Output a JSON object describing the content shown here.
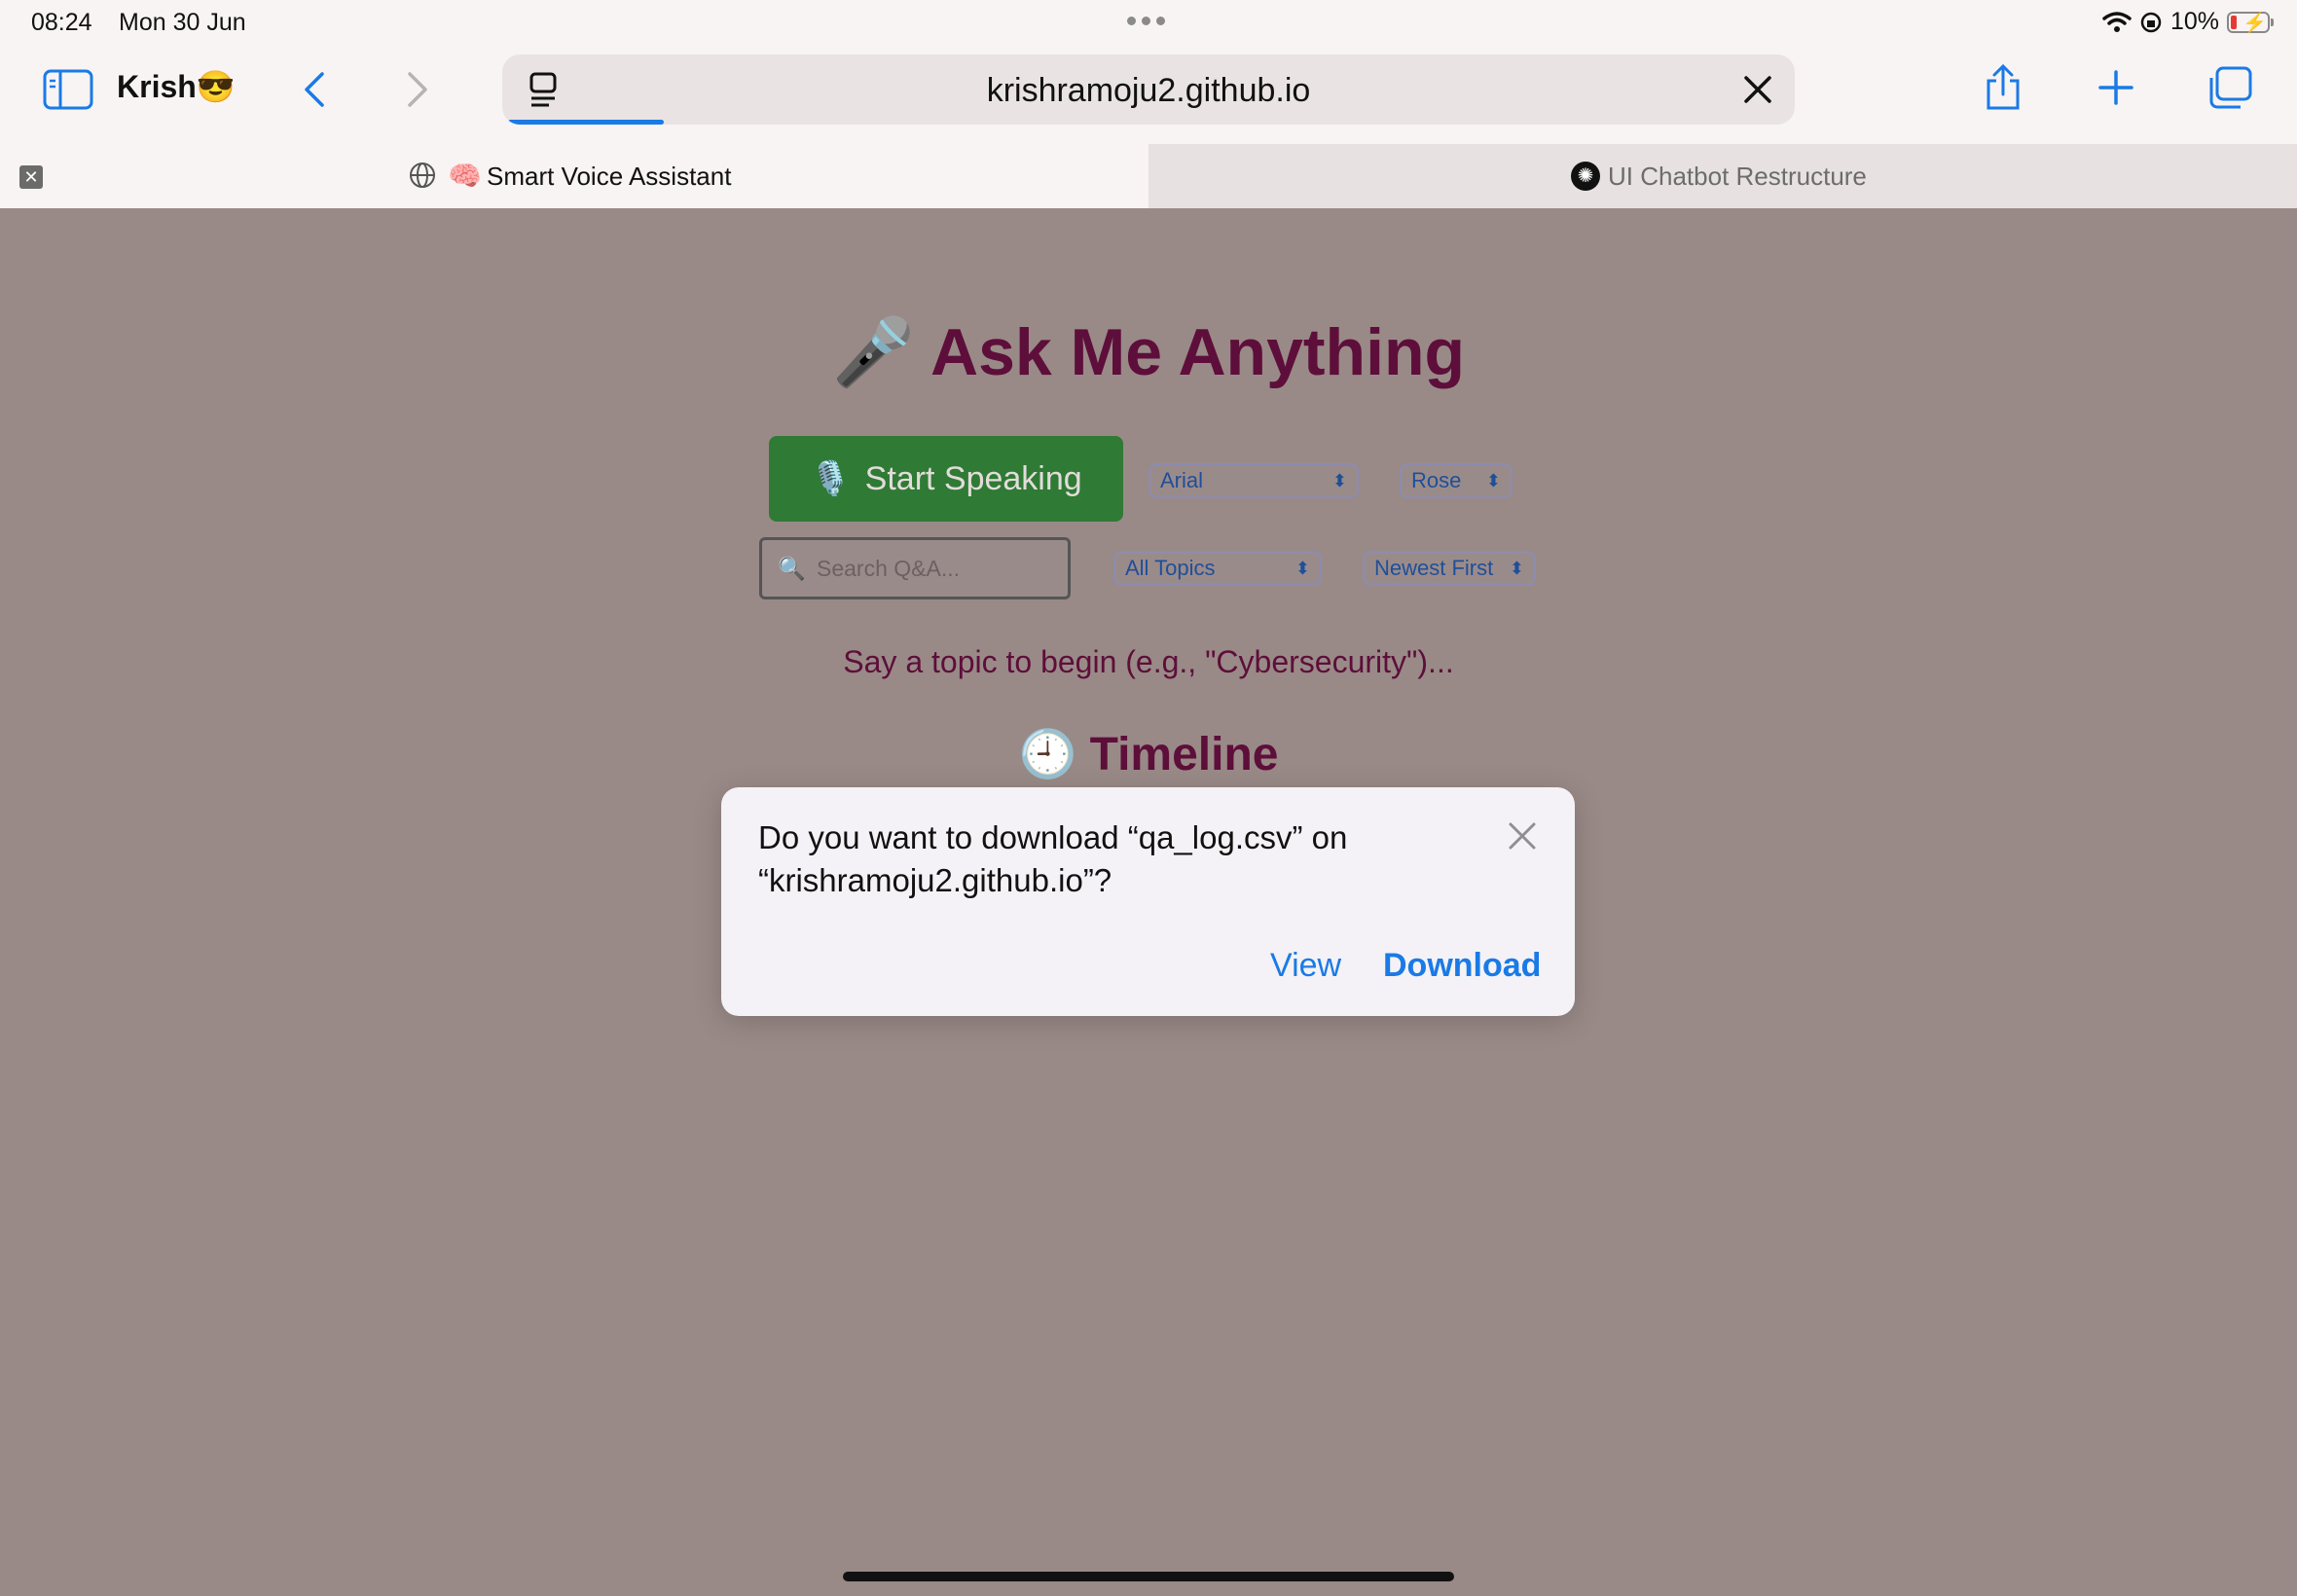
{
  "status_bar": {
    "time": "08:24",
    "date": "Mon 30 Jun",
    "battery": "10%"
  },
  "toolbar": {
    "profile_name": "Krish😎",
    "url": "krishramoju2.github.io"
  },
  "tabs": [
    {
      "label": "Smart Voice Assistant",
      "emoji": "🧠",
      "active": true
    },
    {
      "label": "UI Chatbot Restructure",
      "active": false
    }
  ],
  "page": {
    "heading": "🎤 Ask Me Anything",
    "start_button_label": "Start Speaking",
    "start_button_icon": "🎙️",
    "font_select": "Arial",
    "theme_select": "Rose",
    "search_placeholder": "Search Q&A...",
    "topic_select": "All Topics",
    "sort_select": "Newest First",
    "prompt_text": "Say a topic to begin (e.g., \"Cybersecurity\")...",
    "timeline_heading": "🕘 Timeline"
  },
  "dialog": {
    "message": "Do you want to download “qa_log.csv” on “krishramoju2.github.io”?",
    "view_label": "View",
    "download_label": "Download"
  },
  "colors": {
    "accent": "#1a7ae6",
    "page_bg": "#998a87",
    "heading": "#5e0e3a",
    "speak_button": "#2f7a34"
  }
}
